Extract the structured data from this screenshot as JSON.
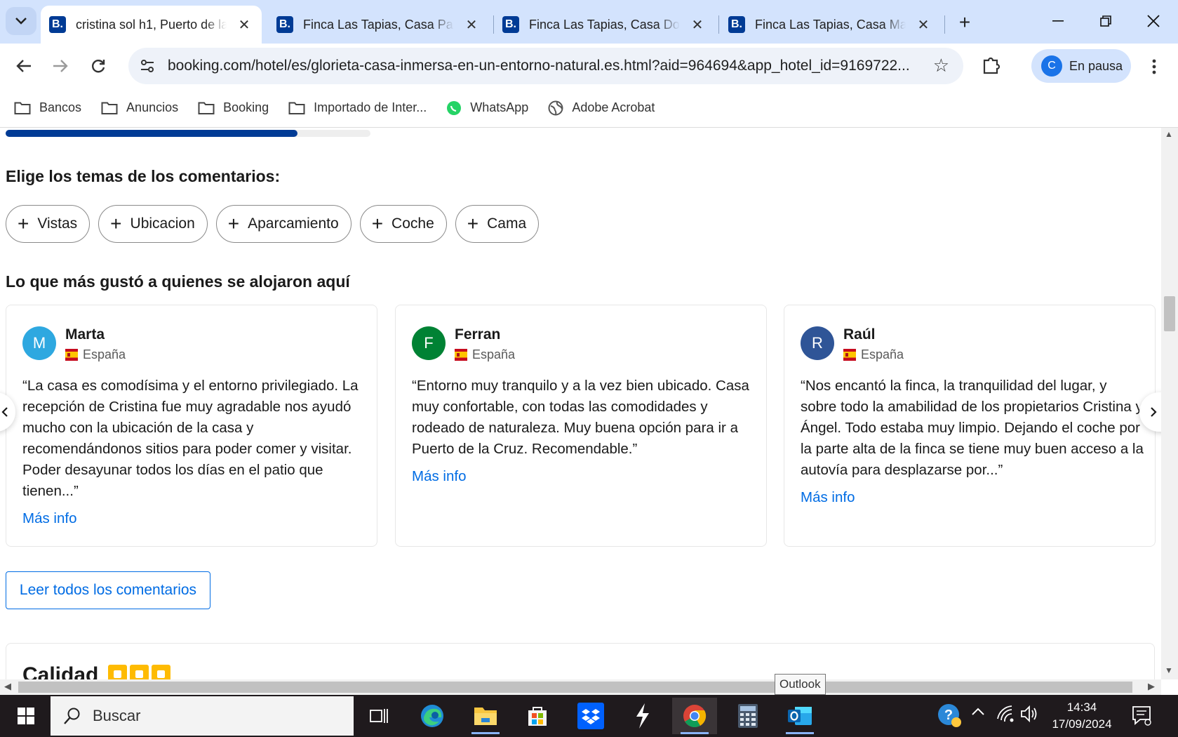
{
  "browser": {
    "tabs": [
      {
        "title": "cristina sol h1, Puerto de la",
        "active": true
      },
      {
        "title": "Finca Las Tapias, Casa Papr",
        "active": false
      },
      {
        "title": "Finca Las Tapias, Casa Don",
        "active": false
      },
      {
        "title": "Finca Las Tapias, Casa Mañ",
        "active": false
      }
    ],
    "favicon_letter": "B.",
    "url": "booking.com/hotel/es/glorieta-casa-inmersa-en-un-entorno-natural.es.html?aid=964694&app_hotel_id=9169722...",
    "profile": {
      "initial": "C",
      "label": "En pausa"
    },
    "bookmarks": [
      {
        "label": "Bancos",
        "icon": "folder-icon"
      },
      {
        "label": "Anuncios",
        "icon": "folder-icon"
      },
      {
        "label": "Booking",
        "icon": "folder-icon"
      },
      {
        "label": "Importado de Inter...",
        "icon": "folder-icon"
      },
      {
        "label": "WhatsApp",
        "icon": "whatsapp-icon"
      },
      {
        "label": "Adobe Acrobat",
        "icon": "globe-icon"
      }
    ]
  },
  "page": {
    "progress_fraction": 0.8,
    "topics_heading": "Elige los temas de los comentarios:",
    "topics": [
      "Vistas",
      "Ubicacion",
      "Aparcamiento",
      "Coche",
      "Cama"
    ],
    "liked_heading": "Lo que más gustó a quienes se alojaron aquí",
    "reviews": [
      {
        "initial": "M",
        "name": "Marta",
        "country": "España",
        "avatar_color": "#2ea8e0",
        "quote": "“La casa es comodísima y el entorno privilegiado. La recepción de Cristina fue muy agradable nos ayudó mucho con la ubicación de la casa y recomendándonos sitios para poder comer y visitar. Poder desayunar todos los días en el patio que tienen...”",
        "more": "Más info"
      },
      {
        "initial": "F",
        "name": "Ferran",
        "country": "España",
        "avatar_color": "#008234",
        "quote": "“Entorno muy tranquilo y a la vez bien ubicado. Casa muy confortable, con todas las comodidades y rodeado de naturaleza. Muy buena opción para ir a Puerto de la Cruz. Recomendable.”",
        "more": "Más info"
      },
      {
        "initial": "R",
        "name": "Raúl",
        "country": "España",
        "avatar_color": "#2f5597",
        "quote": "“Nos encantó la finca, la tranquilidad del lugar, y sobre todo la amabilidad de los propietarios Cristina y Ángel. Todo estaba muy limpio. Dejando el coche por la parte alta de la finca se tiene muy buen acceso a la autovía para desplazarse por...”",
        "more": "Más info"
      }
    ],
    "read_all": "Leer todos los comentarios",
    "quality_title": "Calidad",
    "quality_stars": 3
  },
  "tooltip": "Outlook",
  "taskbar": {
    "search_placeholder": "Buscar",
    "time": "14:34",
    "date": "17/09/2024"
  },
  "colors": {
    "booking_blue": "#003b95",
    "link_blue": "#006ce4",
    "star_yellow": "#febb02"
  }
}
